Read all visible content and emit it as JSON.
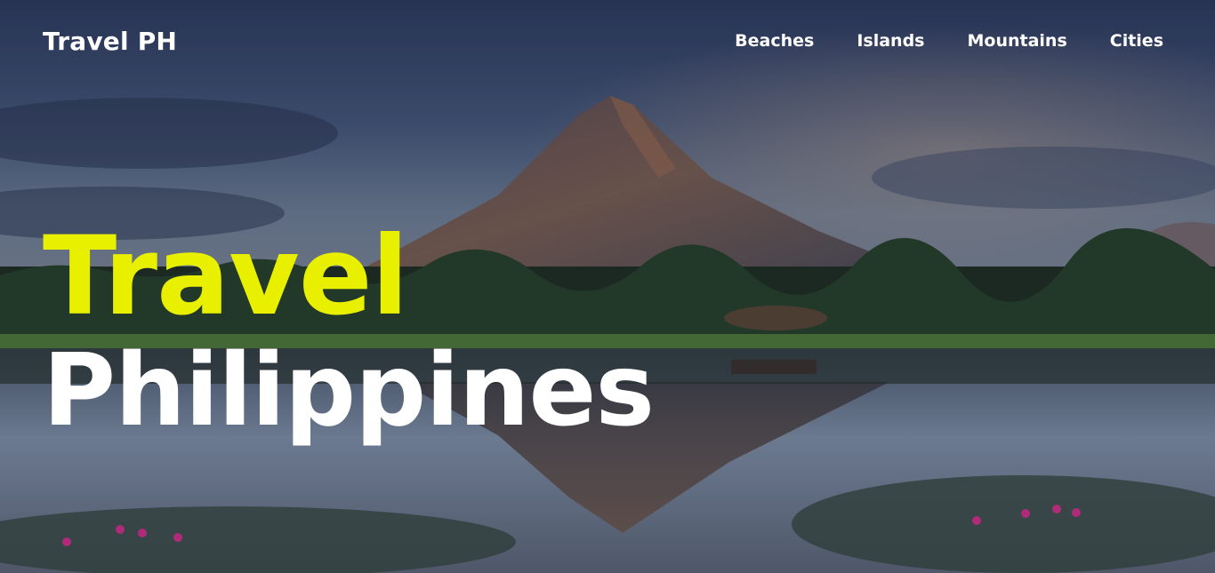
{
  "header": {
    "brand": "Travel PH",
    "nav": [
      {
        "label": "Beaches"
      },
      {
        "label": "Islands"
      },
      {
        "label": "Mountains"
      },
      {
        "label": "Cities"
      }
    ]
  },
  "hero": {
    "title_line1": "Travel",
    "title_line2": "Philippines",
    "title_line1_color": "#e8f000",
    "title_line2_color": "#ffffff",
    "background_image": "mountain-lake-photo"
  }
}
